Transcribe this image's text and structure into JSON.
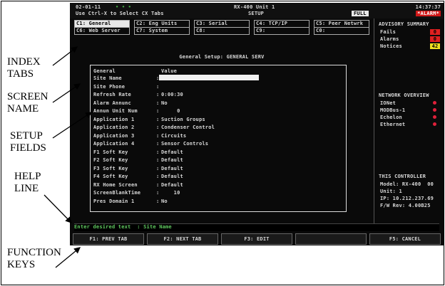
{
  "header": {
    "date": "02-01-11",
    "status_dots": "• • •",
    "hint": "Use Ctrl-X to Select CX Tabs",
    "unit_name": "RX-400 Unit 1",
    "mode": "SETUP",
    "full_badge": "FULL",
    "time": "14:37:37",
    "alarm_badge": "*ALARM*"
  },
  "tabs_row1": [
    "C1: General",
    "C2: Eng Units",
    "C3: Serial",
    "C4: TCP/IP",
    "C5: Peer Netwrk"
  ],
  "tabs_row2": [
    "C6: Web Server",
    "C7: System",
    "C8:",
    "C9:",
    "C0:"
  ],
  "active_tab_index": 0,
  "panel": {
    "title": "General Setup: GENERAL SERV",
    "col_header_general": "General",
    "col_header_value": "Value",
    "fields": [
      {
        "label": "Site Name",
        "value": ""
      },
      {
        "label": "Site Phone",
        "value": ""
      },
      {
        "label": "Refresh Rate",
        "value": "0:00:30"
      },
      {
        "label": "Alarm Annunc",
        "value": "No"
      },
      {
        "label": "Annun Unit Num",
        "value": "     0"
      },
      {
        "label": "Application 1",
        "value": "Suction Groups"
      },
      {
        "label": "Application 2",
        "value": "Condenser Control"
      },
      {
        "label": "Application 3",
        "value": "Circuits"
      },
      {
        "label": "Application 4",
        "value": "Sensor Controls"
      },
      {
        "label": "F1 Soft Key",
        "value": "Default"
      },
      {
        "label": "F2 Soft Key",
        "value": "Default"
      },
      {
        "label": "F3 Soft Key",
        "value": "Default"
      },
      {
        "label": "F4 Soft Key",
        "value": "Default"
      },
      {
        "label": "RX Home Screen",
        "value": "Default"
      },
      {
        "label": "ScreenBlankTime",
        "value": "    10"
      },
      {
        "label": "Pres Domain 1",
        "value": "No"
      }
    ]
  },
  "advisory": {
    "title": "ADVISORY SUMMARY",
    "items": [
      {
        "label": "Fails",
        "value": "0",
        "color": "#e02020"
      },
      {
        "label": "Alarms",
        "value": "0",
        "color": "#e02020"
      },
      {
        "label": "Notices",
        "value": "42",
        "color": "#f0e020"
      }
    ]
  },
  "network": {
    "title": "NETWORK OVERVIEW",
    "items": [
      {
        "label": "IONet",
        "color": "#e0203a"
      },
      {
        "label": "MODBus-1",
        "color": "#e0203a"
      },
      {
        "label": "Echelon",
        "color": "#e0203a"
      },
      {
        "label": "Ethernet",
        "color": "#e0203a"
      }
    ]
  },
  "controller": {
    "title": "THIS CONTROLLER",
    "lines": [
      "Model: RX-400  00",
      "Unit: 1",
      "IP: 10.212.237.69",
      "F/W Rev: 4.00B25"
    ]
  },
  "help_line": "Enter desired text  : Site Name",
  "function_keys": [
    "F1: PREV TAB",
    "F2: NEXT TAB",
    "F3: EDIT",
    "",
    "F5: CANCEL"
  ],
  "callouts": {
    "index_tabs": [
      "INDEX",
      "TABS"
    ],
    "screen_name": [
      "SCREEN",
      "NAME"
    ],
    "setup_fields": [
      "SETUP",
      "FIELDS"
    ],
    "help_line": [
      "HELP",
      "LINE"
    ],
    "function_keys": [
      "FUNCTION",
      "KEYS"
    ]
  }
}
